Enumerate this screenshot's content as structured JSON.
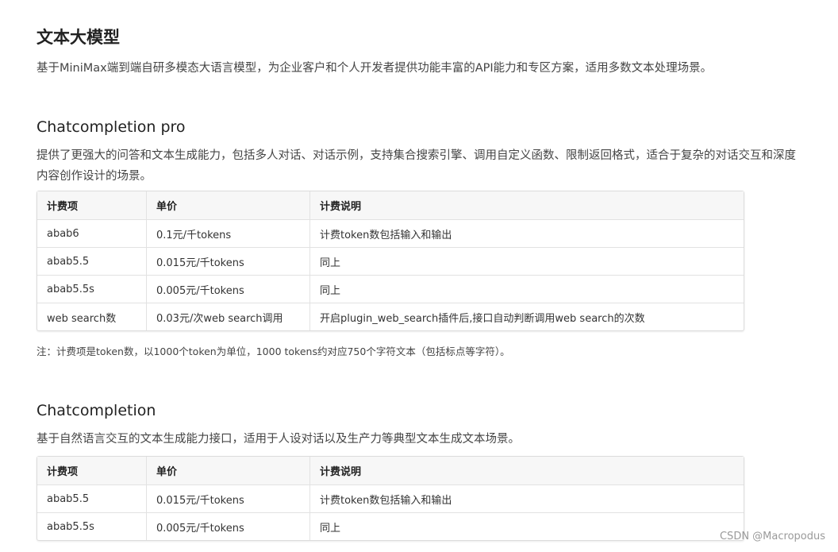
{
  "title": "文本大模型",
  "intro": "基于MiniMax端到端自研多模态大语言模型，为企业客户和个人开发者提供功能丰富的API能力和专区方案，适用多数文本处理场景。",
  "sections": [
    {
      "heading": "Chatcompletion pro",
      "description": "提供了更强大的问答和文本生成能力，包括多人对话、对话示例，支持集合搜索引擎、调用自定义函数、限制返回格式，适合于复杂的对话交互和深度内容创作设计的场景。",
      "table": {
        "headers": [
          "计费项",
          "单价",
          "计费说明"
        ],
        "rows": [
          [
            "abab6",
            "0.1元/千tokens",
            "计费token数包括输入和输出"
          ],
          [
            "abab5.5",
            "0.015元/千tokens",
            "同上"
          ],
          [
            "abab5.5s",
            "0.005元/千tokens",
            "同上"
          ],
          [
            "web search数",
            "0.03元/次web search调用",
            "开启plugin_web_search插件后,接口自动判断调用web search的次数"
          ]
        ]
      },
      "note": "注：计费项是token数，以1000个token为单位，1000 tokens约对应750个字符文本（包括标点等字符）。"
    },
    {
      "heading": "Chatcompletion",
      "description": "基于自然语言交互的文本生成能力接口，适用于人设对话以及生产力等典型文本生成文本场景。",
      "table": {
        "headers": [
          "计费项",
          "单价",
          "计费说明"
        ],
        "rows": [
          [
            "abab5.5",
            "0.015元/千tokens",
            "计费token数包括输入和输出"
          ],
          [
            "abab5.5s",
            "0.005元/千tokens",
            "同上"
          ]
        ]
      }
    }
  ],
  "watermark": "CSDN @Macropodus"
}
